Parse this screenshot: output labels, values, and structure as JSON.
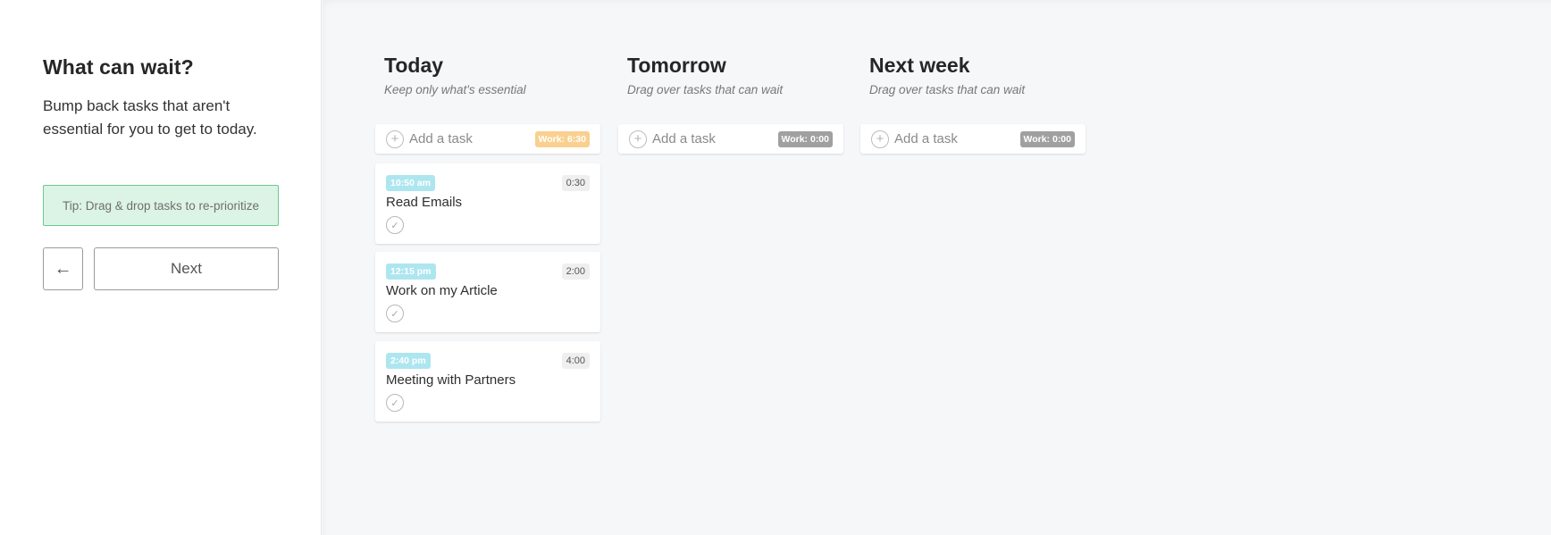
{
  "left_panel": {
    "title": "What can wait?",
    "description": "Bump back tasks that aren't essential for you to get to today.",
    "tip": "Tip: Drag & drop tasks to re-prioritize",
    "back_icon": "←",
    "next_label": "Next"
  },
  "colors": {
    "work_badge_active": "#f9d08f",
    "work_badge_inactive": "#a0a0a0",
    "time_badge": "#aee6f0",
    "tip_bg": "#dcf4e5",
    "tip_border": "#6cc88f"
  },
  "columns": [
    {
      "title": "Today",
      "subtitle": "Keep only what's essential",
      "add_label": "Add a task",
      "plus_icon": "+",
      "work": "Work: 6:30",
      "tasks": [
        {
          "time": "10:50 am",
          "name": "Read Emails",
          "duration": "0:30",
          "check_icon": "✓"
        },
        {
          "time": "12:15 pm",
          "name": "Work on my Article",
          "duration": "2:00",
          "check_icon": "✓"
        },
        {
          "time": "2:40 pm",
          "name": "Meeting with Partners",
          "duration": "4:00",
          "check_icon": "✓"
        }
      ]
    },
    {
      "title": "Tomorrow",
      "subtitle": "Drag over tasks that can wait",
      "add_label": "Add a task",
      "plus_icon": "+",
      "work": "Work: 0:00",
      "tasks": []
    },
    {
      "title": "Next week",
      "subtitle": "Drag over tasks that can wait",
      "add_label": "Add a task",
      "plus_icon": "+",
      "work": "Work: 0:00",
      "tasks": []
    }
  ]
}
